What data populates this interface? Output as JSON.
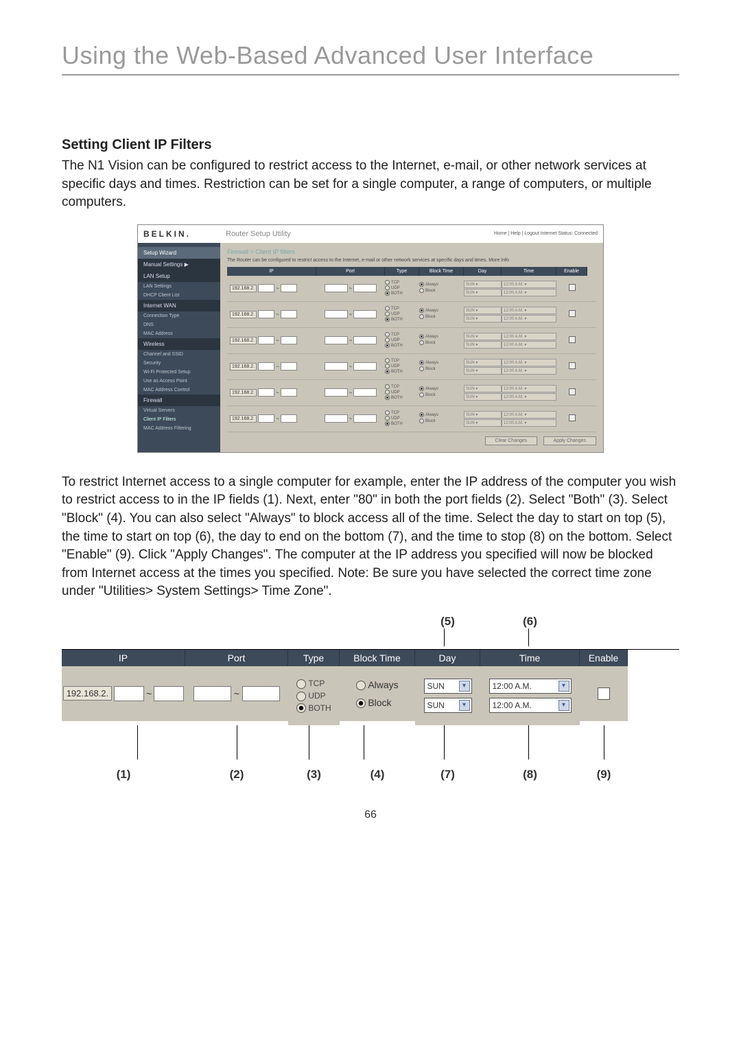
{
  "page": {
    "title": "Using the Web-Based Advanced User Interface",
    "subhead": "Setting Client IP Filters",
    "intro": "The N1 Vision can be configured to restrict access to the Internet, e-mail, or other network services at specific days and times. Restriction can be set for a single computer, a range of computers, or multiple computers.",
    "body": "To restrict Internet access to a single computer for example, enter the IP address of the computer you wish to restrict access to in the IP fields (1). Next, enter \"80\" in both the port fields (2). Select \"Both\" (3). Select \"Block\" (4). You can also select \"Always\" to block access all of the time. Select the day to start on top (5), the time to start on top (6), the day to end on the bottom (7), and the time to stop (8) on the bottom. Select \"Enable\" (9). Click \"Apply Changes\". The computer at the IP address you specified will now be blocked from Internet access at the times you specified. Note: Be sure you have selected the correct time zone under \"Utilities> System Settings> Time Zone\".",
    "page_number": "66"
  },
  "router": {
    "brand": "BELKIN.",
    "utility": "Router Setup Utility",
    "top_links": "Home | Help | Logout   Internet Status: Connected",
    "breadcrumb": "Firewall > Client IP filters",
    "desc": "The Router can be configured to restrict access to the Internet, e-mail or other network services at specific days and times. More Info",
    "sidebar": {
      "wizard": "Setup Wizard",
      "manual": "Manual Settings ▶",
      "items": [
        "LAN Setup",
        "LAN Settings",
        "DHCP Client List",
        "Internet WAN",
        "Connection Type",
        "DNS",
        "MAC Address",
        "Wireless",
        "Channel and SSID",
        "Security",
        "Wi-Fi Protected Setup",
        "Use as Access Point",
        "MAC Address Control",
        "Firewall",
        "Virtual Servers",
        "Client IP Filters",
        "MAC Address Filtering"
      ]
    },
    "headers": {
      "ip": "IP",
      "port": "Port",
      "type": "Type",
      "block": "Block Time",
      "day": "Day",
      "time": "Time",
      "enable": "Enable"
    },
    "ip_prefix": "192.168.2.",
    "type_opts": {
      "tcp": "TCP",
      "udp": "UDP",
      "both": "BOTH"
    },
    "bt_opts": {
      "always": "Always",
      "block": "Block"
    },
    "day_opt": "SUN",
    "time_opt": "12:00 A.M.",
    "row_count": 6,
    "actions": {
      "clear": "Clear Changes",
      "apply": "Apply Changes"
    }
  },
  "detail": {
    "callouts_top": {
      "c5": "(5)",
      "c6": "(6)"
    },
    "callouts_bot": {
      "c1": "(1)",
      "c2": "(2)",
      "c3": "(3)",
      "c4": "(4)",
      "c7": "(7)",
      "c8": "(8)",
      "c9": "(9)"
    },
    "headers": {
      "ip": "IP",
      "port": "Port",
      "type": "Type",
      "block": "Block Time",
      "day": "Day",
      "time": "Time",
      "enable": "Enable"
    },
    "ip_prefix": "192.168.2.",
    "tcp": "TCP",
    "udp": "UDP",
    "both": "BOTH",
    "always": "Always",
    "block": "Block",
    "day": "SUN",
    "time": "12:00 A.M."
  }
}
